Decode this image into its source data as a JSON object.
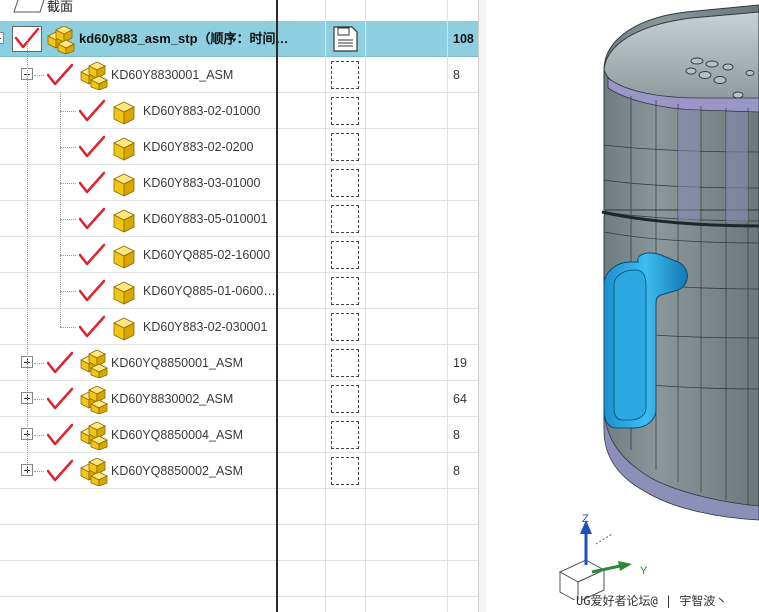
{
  "top_partial_label": "截面",
  "tree": {
    "root": {
      "name": "kd60y883_asm_stp（顺序：时间…",
      "count": "108"
    },
    "rows": [
      {
        "name": "KD60Y8830001_ASM",
        "count": "8",
        "level": 1,
        "expander": "minus"
      },
      {
        "name": "KD60Y883-02-01000",
        "count": "",
        "level": 2,
        "expander": "none"
      },
      {
        "name": "KD60Y883-02-0200",
        "count": "",
        "level": 2,
        "expander": "none"
      },
      {
        "name": "KD60Y883-03-01000",
        "count": "",
        "level": 2,
        "expander": "none"
      },
      {
        "name": "KD60Y883-05-010001",
        "count": "",
        "level": 2,
        "expander": "none"
      },
      {
        "name": "KD60YQ885-02-16000",
        "count": "",
        "level": 2,
        "expander": "none"
      },
      {
        "name": "KD60YQ885-01-0600…",
        "count": "",
        "level": 2,
        "expander": "none"
      },
      {
        "name": "KD60Y883-02-030001",
        "count": "",
        "level": 2,
        "expander": "none"
      },
      {
        "name": "KD60YQ8850001_ASM",
        "count": "19",
        "level": 1,
        "expander": "plus"
      },
      {
        "name": "KD60Y8830002_ASM",
        "count": "64",
        "level": 1,
        "expander": "plus"
      },
      {
        "name": "KD60YQ8850004_ASM",
        "count": "8",
        "level": 1,
        "expander": "plus"
      },
      {
        "name": "KD60YQ8850002_ASM",
        "count": "8",
        "level": 1,
        "expander": "plus"
      }
    ]
  },
  "triad": {
    "z": "Z",
    "y": "Y"
  },
  "watermark": "UG爱好者论坛@ | 宇智波丶",
  "colors": {
    "selection": "#8ecfdf",
    "check": "#e0222e",
    "component": "#f2c414",
    "handle": "#1ea3e0",
    "body": "#6e7c7e"
  }
}
